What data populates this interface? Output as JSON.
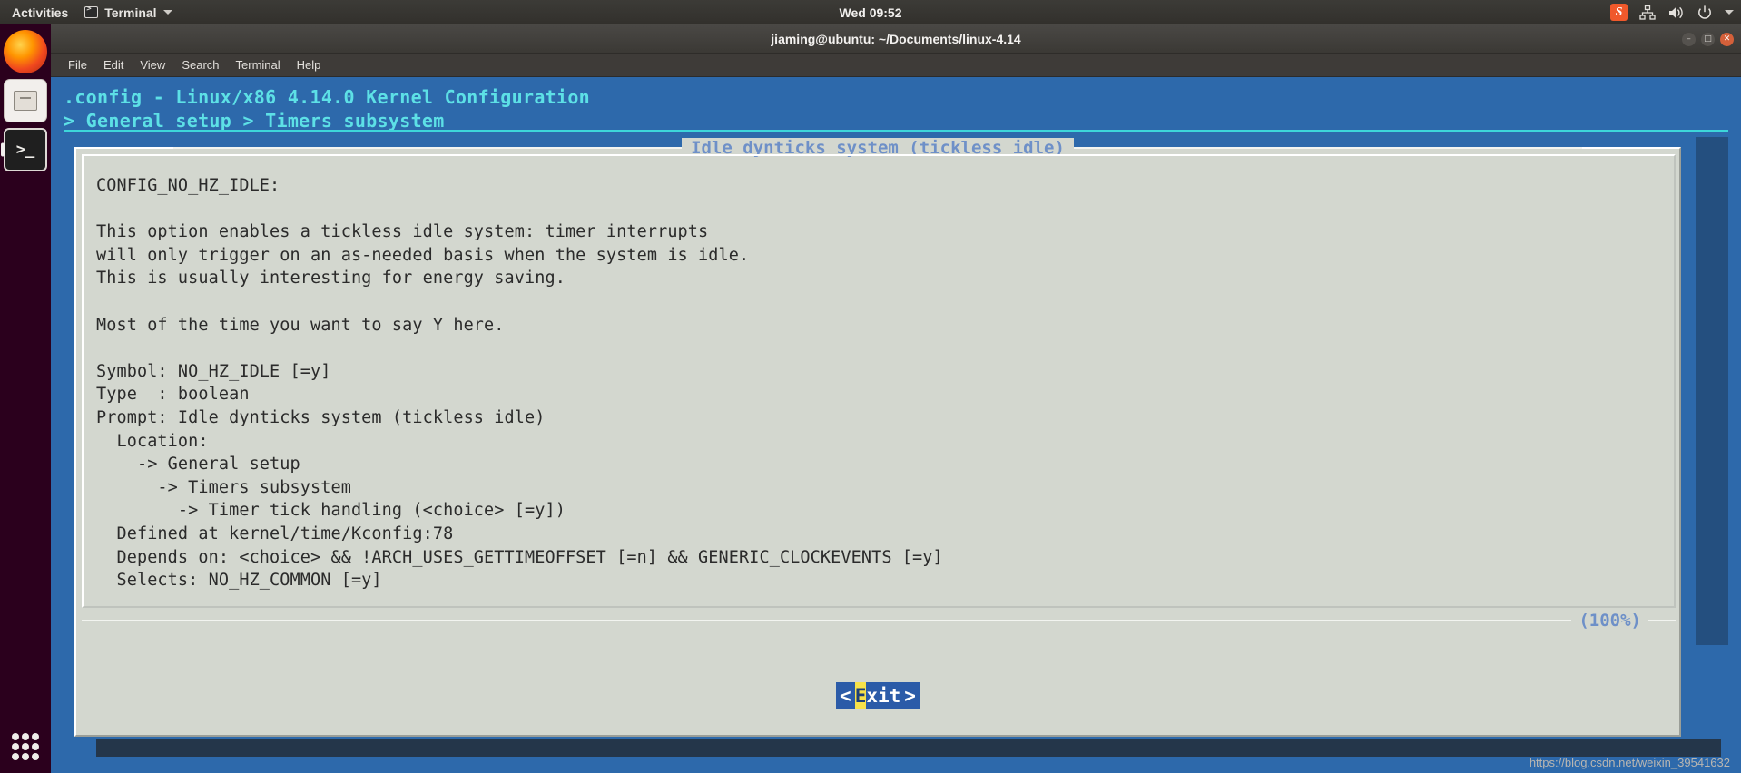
{
  "topbar": {
    "activities": "Activities",
    "app_name": "Terminal",
    "clock": "Wed 09:52",
    "tray": {
      "ime": "S",
      "network_icon": "network-icon",
      "volume_icon": "volume-icon",
      "power_icon": "power-icon",
      "dropdown_icon": "chevron-down-icon"
    }
  },
  "dock": {
    "items": [
      {
        "name": "firefox",
        "label": "Firefox"
      },
      {
        "name": "files",
        "label": "Files"
      },
      {
        "name": "terminal",
        "label": "Terminal"
      }
    ],
    "show_apps_label": "Show Applications"
  },
  "window": {
    "title": "jiaming@ubuntu: ~/Documents/linux-4.14",
    "controls": {
      "minimize": "–",
      "maximize": "□",
      "close": "✕"
    },
    "menu": [
      "File",
      "Edit",
      "View",
      "Search",
      "Terminal",
      "Help"
    ]
  },
  "menuconfig": {
    "title": ".config - Linux/x86 4.14.0 Kernel Configuration",
    "breadcrumb": "> General setup > Timers subsystem",
    "dialog_title": "Idle dynticks system (tickless idle)",
    "percent": "(100%)",
    "body_lines": [
      "CONFIG_NO_HZ_IDLE:",
      "",
      "This option enables a tickless idle system: timer interrupts",
      "will only trigger on an as-needed basis when the system is idle.",
      "This is usually interesting for energy saving.",
      "",
      "Most of the time you want to say Y here.",
      "",
      "Symbol: NO_HZ_IDLE [=y]",
      "Type  : boolean",
      "Prompt: Idle dynticks system (tickless idle)",
      "  Location:",
      "    -> General setup",
      "      -> Timers subsystem",
      "        -> Timer tick handling (<choice> [=y])",
      "  Defined at kernel/time/Kconfig:78",
      "  Depends on: <choice> && !ARCH_USES_GETTIMEOFFSET [=n] && GENERIC_CLOCKEVENTS [=y]",
      "  Selects: NO_HZ_COMMON [=y]"
    ],
    "exit_button": {
      "left_bracket": "<",
      "accel": "E",
      "rest": "xit",
      "right_bracket": ">"
    }
  },
  "watermark": "https://blog.csdn.net/weixin_39541632",
  "colors": {
    "tui_bg": "#2d69ab",
    "tui_text": "#5de0e6",
    "dialog_bg": "#d3d7cf",
    "dialog_title": "#6e90c8",
    "button_bg": "#2b5ba8",
    "accel": "#f7e24a"
  }
}
